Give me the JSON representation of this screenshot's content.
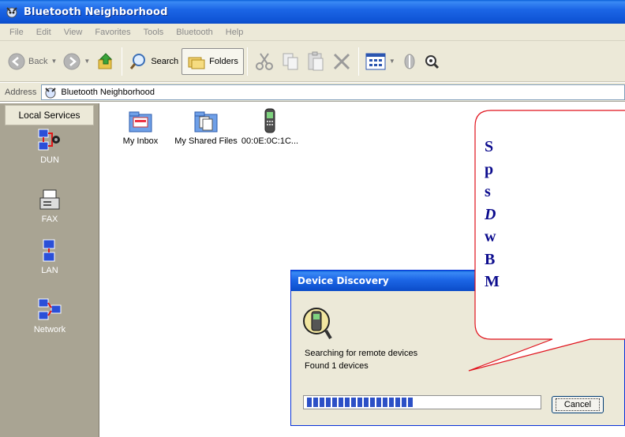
{
  "window": {
    "title": "Bluetooth Neighborhood"
  },
  "menubar": {
    "items": [
      "File",
      "Edit",
      "View",
      "Favorites",
      "Tools",
      "Bluetooth",
      "Help"
    ]
  },
  "toolbar": {
    "back_label": "Back",
    "search_label": "Search",
    "folders_label": "Folders"
  },
  "address": {
    "label": "Address",
    "value": "Bluetooth Neighborhood"
  },
  "sidebar": {
    "header": "Local Services",
    "services": [
      {
        "label": "DUN",
        "icon": "dun-icon"
      },
      {
        "label": "FAX",
        "icon": "fax-icon"
      },
      {
        "label": "LAN",
        "icon": "lan-icon"
      },
      {
        "label": "Network",
        "icon": "network-icon"
      }
    ]
  },
  "content": {
    "items": [
      {
        "label": "My Inbox",
        "icon": "inbox-folder-icon"
      },
      {
        "label": "My Shared Files",
        "icon": "shared-folder-icon"
      },
      {
        "label": "00:0E:0C:1C...",
        "icon": "phone-device-icon"
      }
    ]
  },
  "dialog": {
    "title": "Device Discovery",
    "status_line1": "Searching for remote devices",
    "status_line2": "Found 1 devices",
    "progress_segments": 17,
    "cancel_label": "Cancel"
  },
  "callout": {
    "lines": [
      "S",
      "p",
      "s",
      "D",
      "w",
      "B",
      "M"
    ]
  },
  "colors": {
    "titlebar": "#0a5fd8",
    "chrome": "#ece9d8",
    "sidebar": "#a9a493",
    "callout_border": "#e0101a",
    "callout_text": "#0c0c8e"
  }
}
